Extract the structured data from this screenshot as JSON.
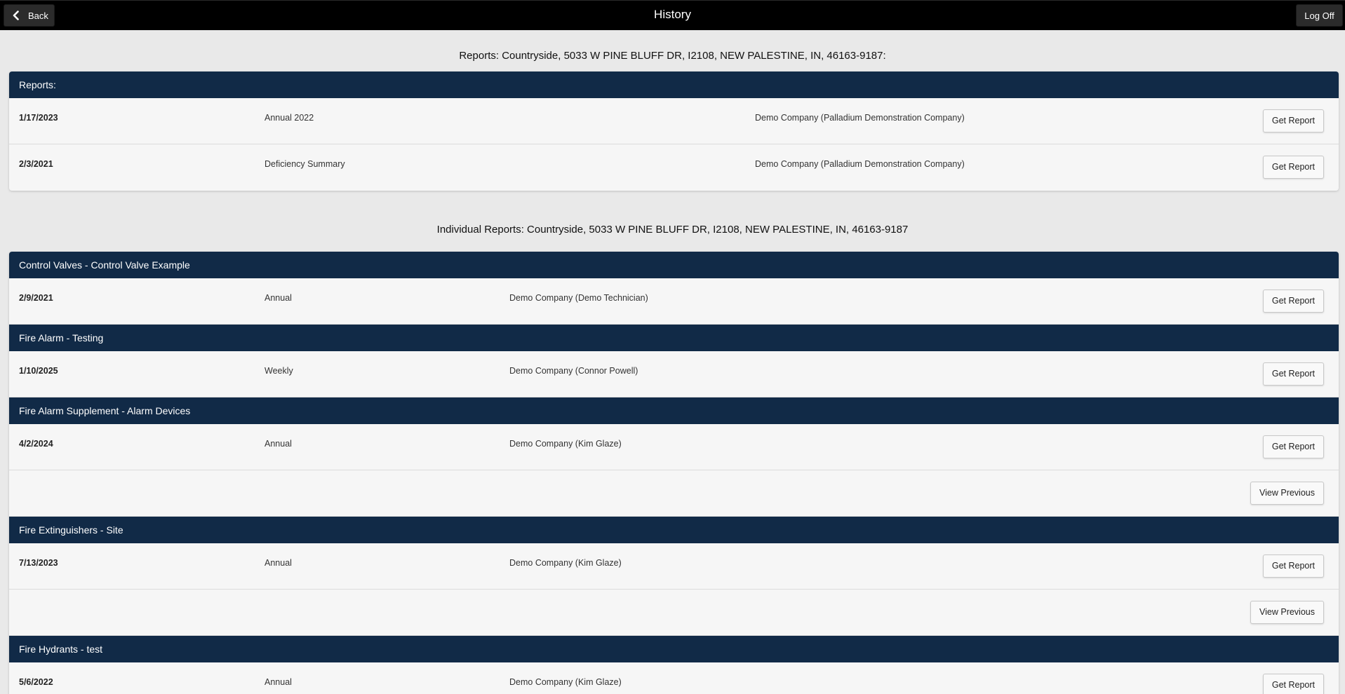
{
  "header": {
    "title": "History",
    "back_label": "Back",
    "logoff_label": "Log Off"
  },
  "reports_section": {
    "heading": "Reports: Countryside, 5033 W PINE BLUFF DR, I2108, NEW PALESTINE, IN, 46163-9187:",
    "bar_label": "Reports:",
    "rows": [
      {
        "date": "1/17/2023",
        "type": "Annual 2022",
        "company": "Demo Company (Palladium Demonstration Company)",
        "button": "Get Report"
      },
      {
        "date": "2/3/2021",
        "type": "Deficiency Summary",
        "company": "Demo Company (Palladium Demonstration Company)",
        "button": "Get Report"
      }
    ]
  },
  "individual_section": {
    "heading": "Individual Reports: Countryside, 5033 W PINE BLUFF DR, I2108, NEW PALESTINE, IN, 46163-9187",
    "groups": [
      {
        "title": "Control Valves - Control Valve Example",
        "rows": [
          {
            "date": "2/9/2021",
            "type": "Annual",
            "company": "Demo Company (Demo Technician)",
            "button": "Get Report"
          }
        ]
      },
      {
        "title": "Fire Alarm - Testing",
        "rows": [
          {
            "date": "1/10/2025",
            "type": "Weekly",
            "company": "Demo Company (Connor Powell)",
            "button": "Get Report"
          }
        ]
      },
      {
        "title": "Fire Alarm Supplement - Alarm Devices",
        "rows": [
          {
            "date": "4/2/2024",
            "type": "Annual",
            "company": "Demo Company (Kim Glaze)",
            "button": "Get Report"
          }
        ],
        "view_previous": "View Previous"
      },
      {
        "title": "Fire Extinguishers - Site",
        "rows": [
          {
            "date": "7/13/2023",
            "type": "Annual",
            "company": "Demo Company (Kim Glaze)",
            "button": "Get Report"
          }
        ],
        "view_previous": "View Previous"
      },
      {
        "title": "Fire Hydrants - test",
        "rows": [
          {
            "date": "5/6/2022",
            "type": "Annual",
            "company": "Demo Company (Kim Glaze)",
            "button": "Get Report"
          }
        ]
      }
    ]
  },
  "icons": {
    "back": "chevron-left-icon"
  },
  "colors": {
    "header_bg": "#000000",
    "bar_bg": "#112a47",
    "page_bg": "#e9e9e9"
  }
}
